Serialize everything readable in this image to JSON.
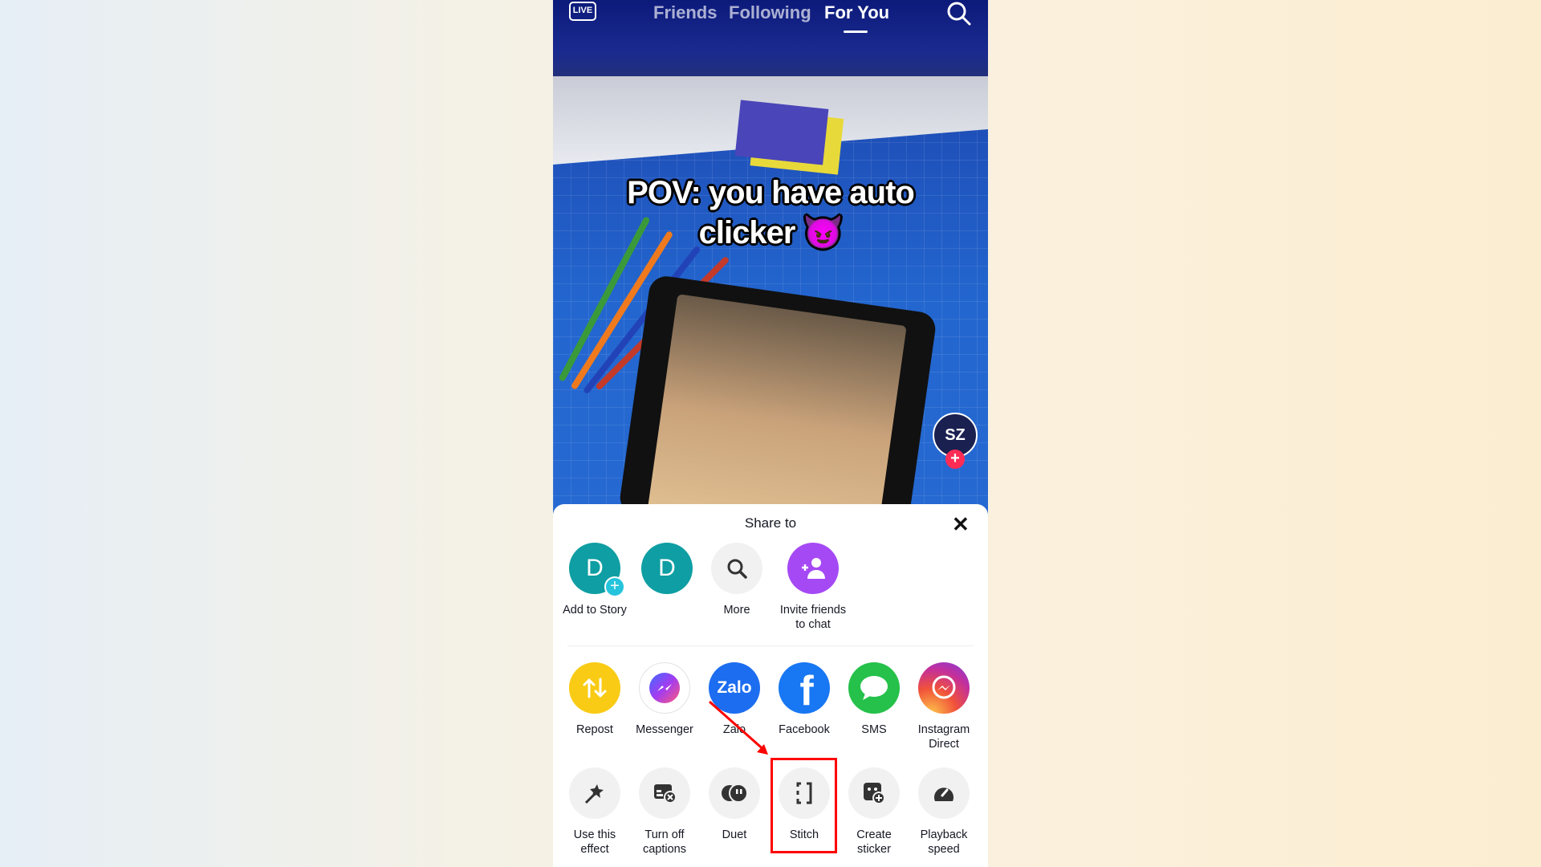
{
  "topnav": {
    "live_label": "LIVE",
    "tabs": [
      {
        "label": "Friends"
      },
      {
        "label": "Following"
      },
      {
        "label": "For You",
        "active": true
      }
    ]
  },
  "video": {
    "caption_line1": "POV: you have auto",
    "caption_line2": "clicker 😈",
    "creator_initials": "SZ"
  },
  "share_sheet": {
    "title": "Share to",
    "contacts": [
      {
        "label": "Add to Story",
        "initial": "D",
        "color": "#0e9ea3"
      },
      {
        "label": "",
        "initial": "D",
        "color": "#0e9ea3"
      },
      {
        "label": "More",
        "icon": "search-icon"
      },
      {
        "label_line1": "Invite friends",
        "label_line2": "to chat",
        "icon": "add-user-icon",
        "color": "#a549f5"
      }
    ],
    "apps": [
      {
        "label": "Repost",
        "color": "#f9cb14"
      },
      {
        "label": "Messenger"
      },
      {
        "label": "Zalo",
        "logo_text": "Zalo",
        "color": "#1c6df0"
      },
      {
        "label": "Facebook",
        "logo_text": "f",
        "color": "#1877f2"
      },
      {
        "label": "SMS",
        "color": "#25c14a"
      },
      {
        "label_line1": "Instagram",
        "label_line2": "Direct"
      }
    ],
    "actions": [
      {
        "label_line1": "Use this",
        "label_line2": "effect",
        "icon": "magic-wand-icon"
      },
      {
        "label_line1": "Turn off",
        "label_line2": "captions",
        "icon": "captions-off-icon"
      },
      {
        "label_line1": "Duet",
        "icon": "duet-icon"
      },
      {
        "label_line1": "Stitch",
        "icon": "stitch-icon",
        "highlighted": true
      },
      {
        "label_line1": "Create",
        "label_line2": "sticker",
        "icon": "sticker-icon"
      },
      {
        "label_line1": "Playback",
        "label_line2": "speed",
        "icon": "speedometer-icon"
      }
    ]
  },
  "colors": {
    "highlight": "#ff0000",
    "follow": "#fe2c55"
  }
}
